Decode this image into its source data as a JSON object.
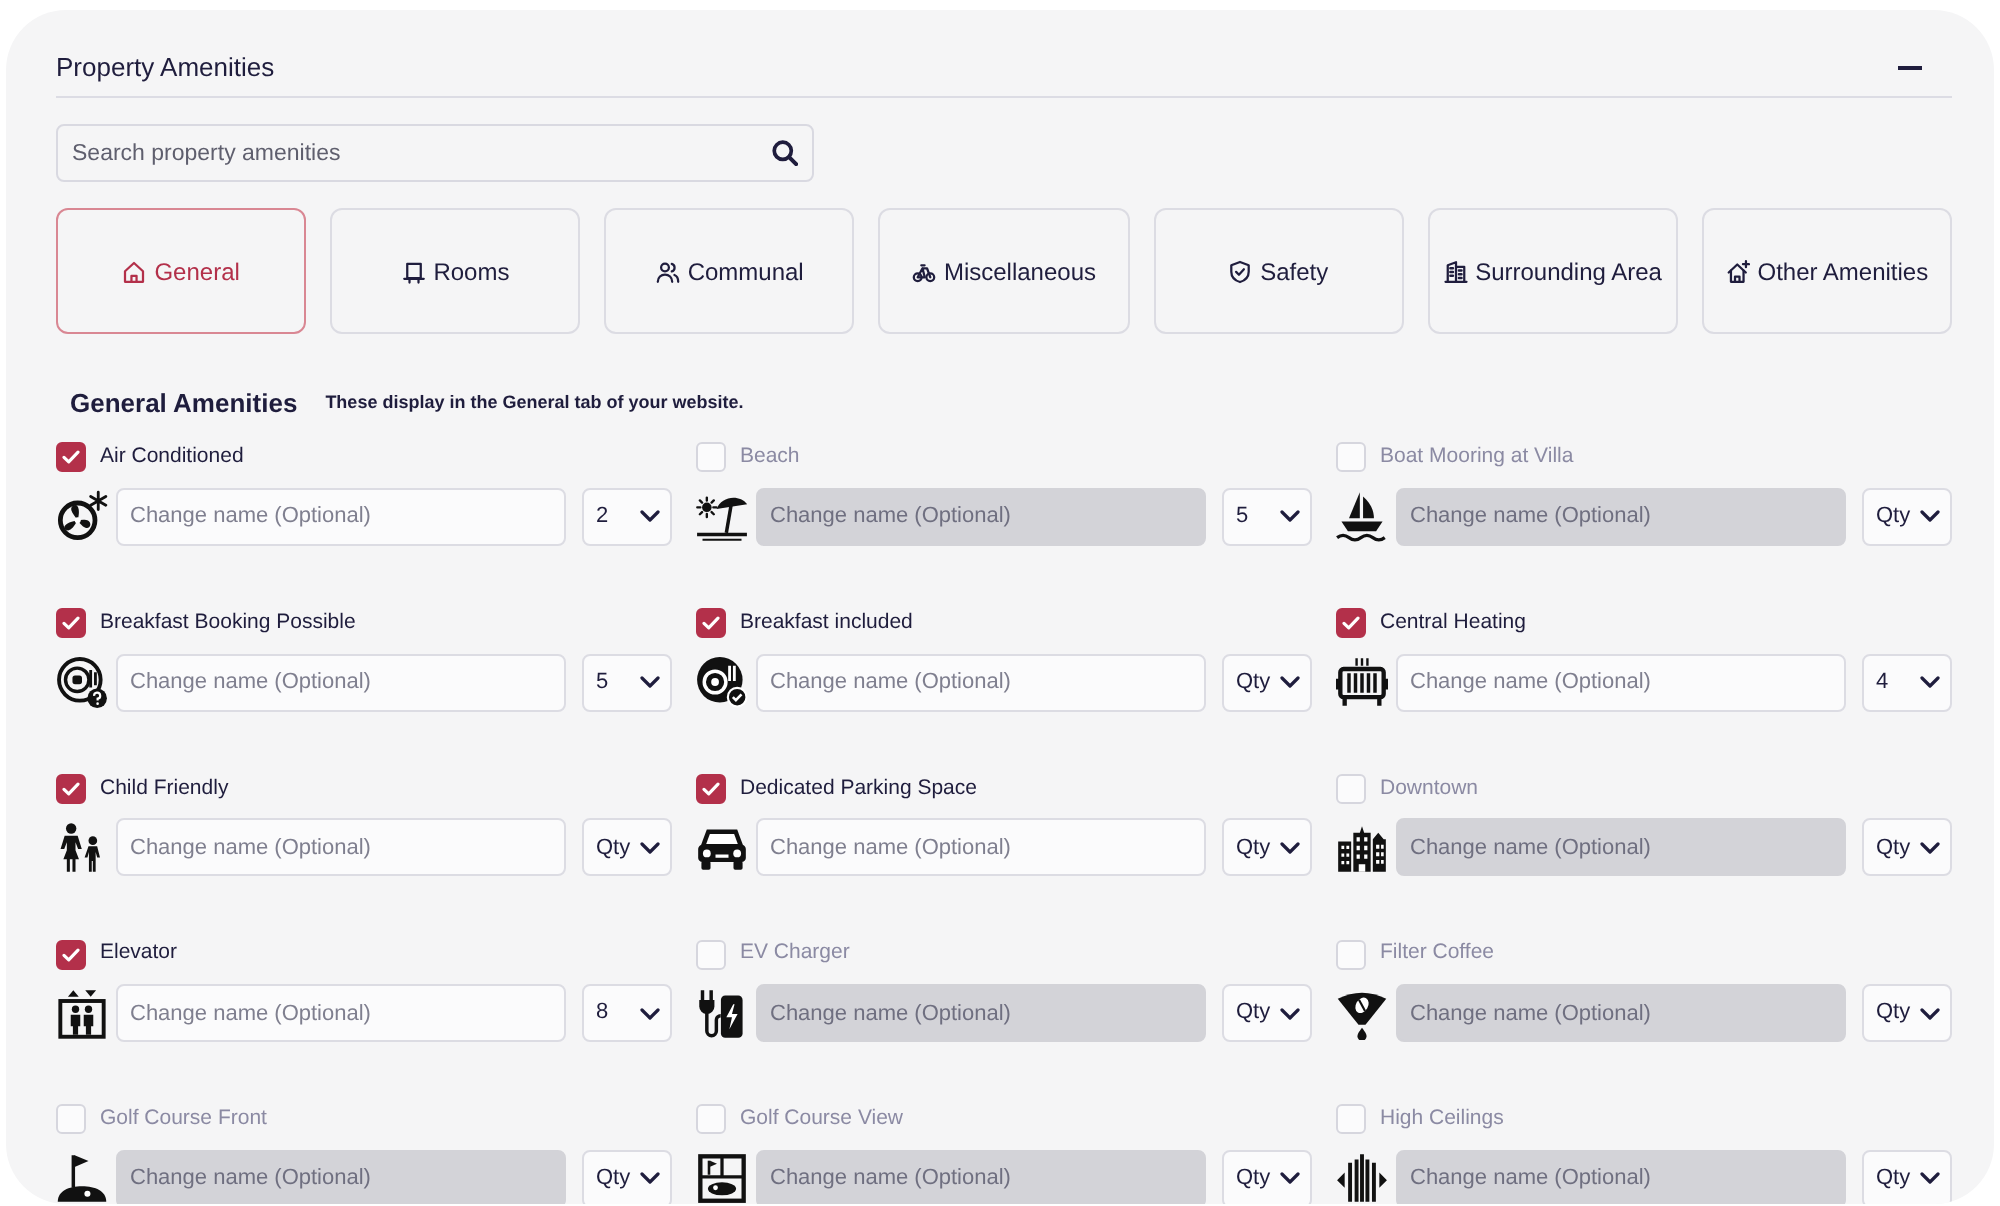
{
  "panel": {
    "title": "Property Amenities"
  },
  "search": {
    "placeholder": "Search property amenities"
  },
  "tabs": [
    {
      "label": "General",
      "selected": true
    },
    {
      "label": "Rooms",
      "selected": false
    },
    {
      "label": "Communal",
      "selected": false
    },
    {
      "label": "Miscellaneous",
      "selected": false
    },
    {
      "label": "Safety",
      "selected": false
    },
    {
      "label": "Surrounding Area",
      "selected": false
    },
    {
      "label": "Other Amenities",
      "selected": false
    }
  ],
  "section": {
    "title": "General Amenities",
    "subtitle": "These display in the General tab of your website."
  },
  "amenities": [
    {
      "label": "Air Conditioned",
      "checked": true,
      "placeholder": "Change name (Optional)",
      "quantity": "2"
    },
    {
      "label": "Beach",
      "checked": false,
      "placeholder": "Change name (Optional)",
      "quantity": "5"
    },
    {
      "label": "Boat Mooring at Villa",
      "checked": false,
      "placeholder": "Change name (Optional)",
      "quantity": "Qty"
    },
    {
      "label": "Breakfast Booking Possible",
      "checked": true,
      "placeholder": "Change name (Optional)",
      "quantity": "5"
    },
    {
      "label": "Breakfast included",
      "checked": true,
      "placeholder": "Change name (Optional)",
      "quantity": "Qty"
    },
    {
      "label": "Central Heating",
      "checked": true,
      "placeholder": "Change name (Optional)",
      "quantity": "4"
    },
    {
      "label": "Child Friendly",
      "checked": true,
      "placeholder": "Change name (Optional)",
      "quantity": "Qty"
    },
    {
      "label": "Dedicated Parking Space",
      "checked": true,
      "placeholder": "Change name (Optional)",
      "quantity": "Qty"
    },
    {
      "label": "Downtown",
      "checked": false,
      "placeholder": "Change name (Optional)",
      "quantity": "Qty"
    },
    {
      "label": "Elevator",
      "checked": true,
      "placeholder": "Change name (Optional)",
      "quantity": "8"
    },
    {
      "label": "EV Charger",
      "checked": false,
      "placeholder": "Change name (Optional)",
      "quantity": "Qty"
    },
    {
      "label": "Filter Coffee",
      "checked": false,
      "placeholder": "Change name (Optional)",
      "quantity": "Qty"
    },
    {
      "label": "Golf Course Front",
      "checked": false,
      "placeholder": "Change name (Optional)",
      "quantity": "Qty"
    },
    {
      "label": "Golf Course View",
      "checked": false,
      "placeholder": "Change name (Optional)",
      "quantity": "Qty"
    },
    {
      "label": "High Ceilings",
      "checked": false,
      "placeholder": "Change name (Optional)",
      "quantity": "Qty"
    }
  ]
}
